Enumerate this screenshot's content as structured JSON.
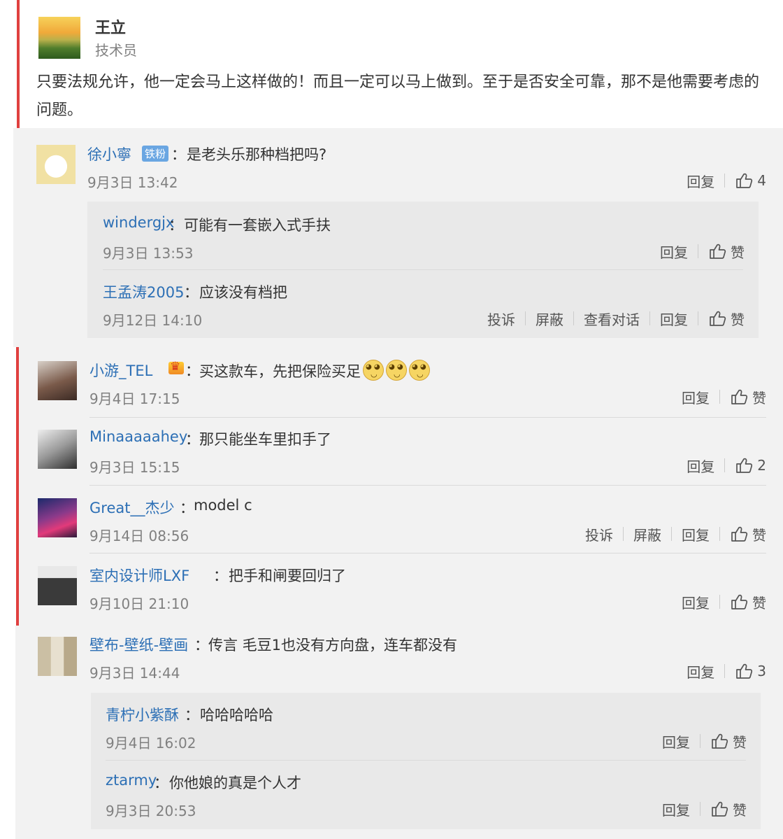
{
  "post": {
    "author": "王立",
    "role": "技术员",
    "text": "只要法规允许，他一定会马上这样做的！而且一定可以马上做到。至于是否安全可靠，那不是他需要考虑的问题。"
  },
  "labels": {
    "reply": "回复",
    "like": "赞",
    "report": "投诉",
    "block": "屏蔽",
    "view_conversation": "查看对话",
    "badge_fan": "铁粉",
    "colon": "："
  },
  "threads": [
    {
      "comment": {
        "user": "徐小寧",
        "text": "是老头乐那种档把吗?",
        "time": "9月3日 13:42",
        "likes": "4"
      },
      "replies": [
        {
          "user": "windergjx",
          "text": "可能有一套嵌入式手扶",
          "time": "9月3日 13:53",
          "likes": "赞"
        },
        {
          "user": "王孟涛2005",
          "text": "应该没有档把",
          "time": "9月12日 14:10",
          "likes": "赞"
        }
      ]
    },
    {
      "comments": [
        {
          "user": "小游_TEL",
          "text": "买这款车，先把保险买足",
          "time": "9月4日 17:15",
          "likes": "赞"
        },
        {
          "user": "Minaaaaahey",
          "text": "那只能坐车里扣手了",
          "time": "9月3日 15:15",
          "likes": "2"
        },
        {
          "user": "Great__杰少",
          "text": "model c",
          "time": "9月14日 08:56",
          "likes": "赞"
        },
        {
          "user": "室内设计师LXF",
          "text": "把手和闸要回归了",
          "time": "9月10日 21:10",
          "likes": "赞"
        }
      ]
    },
    {
      "comment": {
        "user": "壁布-壁纸-壁画",
        "text": "传言 毛豆1也没有方向盘，连车都没有",
        "time": "9月3日 14:44",
        "likes": "3"
      },
      "replies": [
        {
          "user": "青柠小紫酥",
          "text": "哈哈哈哈哈",
          "time": "9月4日 16:02",
          "likes": "赞"
        },
        {
          "user": "ztarmy",
          "text": "你他娘的真是个人才",
          "time": "9月3日 20:53",
          "likes": "赞"
        }
      ]
    }
  ],
  "colors": {
    "link": "#2c6fb5",
    "accent_bar": "#e0403f",
    "thread_bg": "#f2f2f2",
    "reply_bg": "#e9e9e9"
  },
  "icons": [
    "thumbs-up-icon",
    "crown-icon",
    "doge-emoji-icon",
    "fan-badge"
  ]
}
